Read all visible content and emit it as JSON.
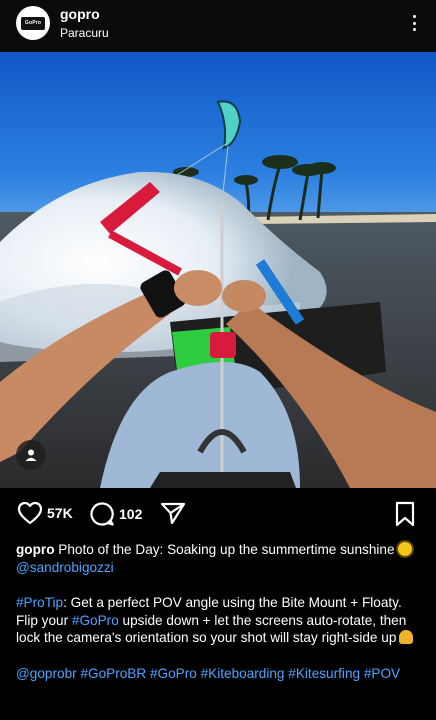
{
  "header": {
    "avatar_text": "GoPro",
    "username": "gopro",
    "location": "Paracuru"
  },
  "actions": {
    "likes": "57K",
    "comments": "102"
  },
  "caption": {
    "p1_username": "gopro",
    "p1_text": "Photo of the Day: Soaking up the summertime sunshine",
    "p1_mention": "@sandrobigozzi",
    "p2_hashtag": "#ProTip",
    "p2_text_a": ": Get a perfect POV angle using the Bite Mount + Floaty. Flip your ",
    "p2_hashtag2": "#GoPro",
    "p2_text_b": " upside down + let the screens auto-rotate, then lock the camera's orientation so your shot will stay right-side up",
    "p3_tags": [
      "@goprobr",
      "#GoProBR",
      "#GoPro",
      "#Kiteboarding",
      "#Kitesurfing",
      "#POV"
    ]
  },
  "colors": {
    "link": "#4da3ff",
    "header_bg": "#0b0b0d"
  }
}
